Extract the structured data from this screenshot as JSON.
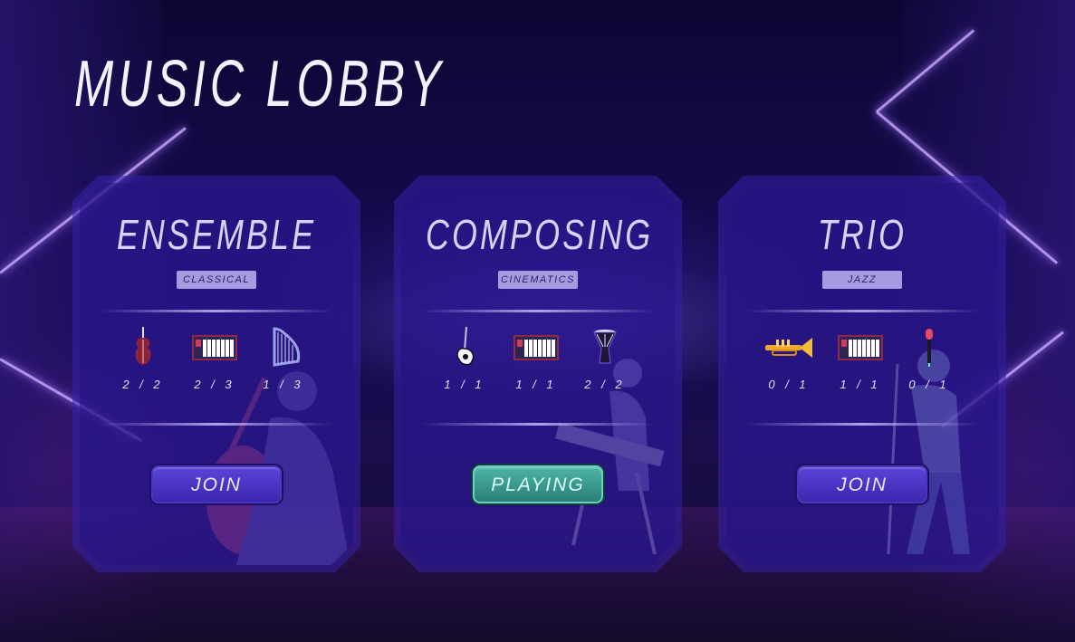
{
  "lobby": {
    "title": "MUSIC LOBBY"
  },
  "rooms": [
    {
      "name": "ENSEMBLE",
      "genre": "CLASSICAL",
      "slots": [
        {
          "instrument": "violin-icon",
          "count": "2 / 2"
        },
        {
          "instrument": "keyboard-icon",
          "count": "2 / 3"
        },
        {
          "instrument": "harp-icon",
          "count": "1 / 3"
        }
      ],
      "button": "JOIN",
      "status": "join"
    },
    {
      "name": "COMPOSING",
      "genre": "CINEMATICS",
      "slots": [
        {
          "instrument": "electric-guitar-icon",
          "count": "1 / 1"
        },
        {
          "instrument": "keyboard-icon",
          "count": "1 / 1"
        },
        {
          "instrument": "djembe-drum-icon",
          "count": "2 / 2"
        }
      ],
      "button": "PLAYING",
      "status": "playing"
    },
    {
      "name": "TRIO",
      "genre": "JAZZ",
      "slots": [
        {
          "instrument": "trumpet-icon",
          "count": "0 / 1"
        },
        {
          "instrument": "keyboard-icon",
          "count": "1 / 1"
        },
        {
          "instrument": "microphone-icon",
          "count": "0 / 1"
        }
      ],
      "button": "JOIN",
      "status": "join"
    }
  ],
  "colors": {
    "card": "#3620aa",
    "join_button": "#4a36c8",
    "playing_button": "#3f9e92",
    "genre_badge": "#a79be0"
  }
}
